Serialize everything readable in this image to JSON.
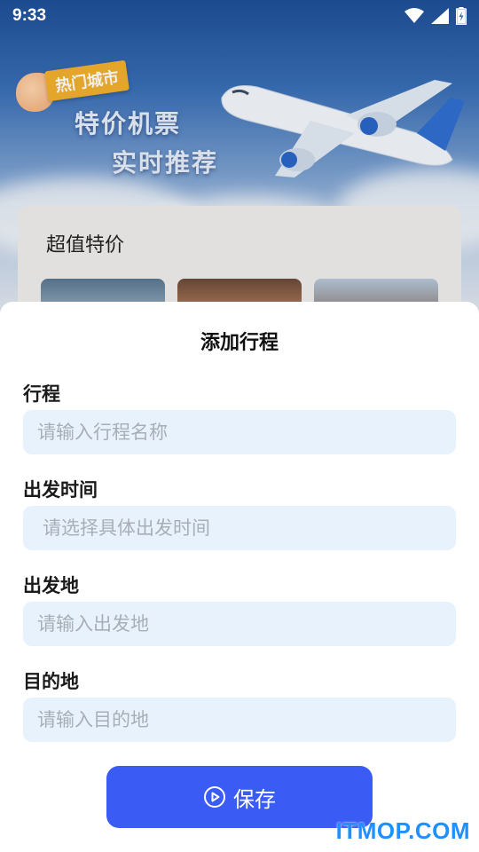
{
  "status_bar": {
    "time": "9:33",
    "icons": [
      "wifi-icon",
      "cell-signal-icon",
      "battery-charging-icon"
    ]
  },
  "hero": {
    "tag": "热门城市",
    "title_line1": "特价机票",
    "title_line2": "实时推荐"
  },
  "deals": {
    "title": "超值特价"
  },
  "sheet": {
    "title": "添加行程",
    "fields": [
      {
        "label": "行程",
        "placeholder": "请输入行程名称",
        "value": ""
      },
      {
        "label": "出发时间",
        "placeholder": "请选择具体出发时间",
        "value": ""
      },
      {
        "label": "出发地",
        "placeholder": "请输入出发地",
        "value": ""
      },
      {
        "label": "目的地",
        "placeholder": "请输入目的地",
        "value": ""
      }
    ],
    "save_label": "保存",
    "accent_color": "#3a5cf5",
    "input_bg_color": "#e8f2fd"
  },
  "watermark": "ITMOP.COM"
}
